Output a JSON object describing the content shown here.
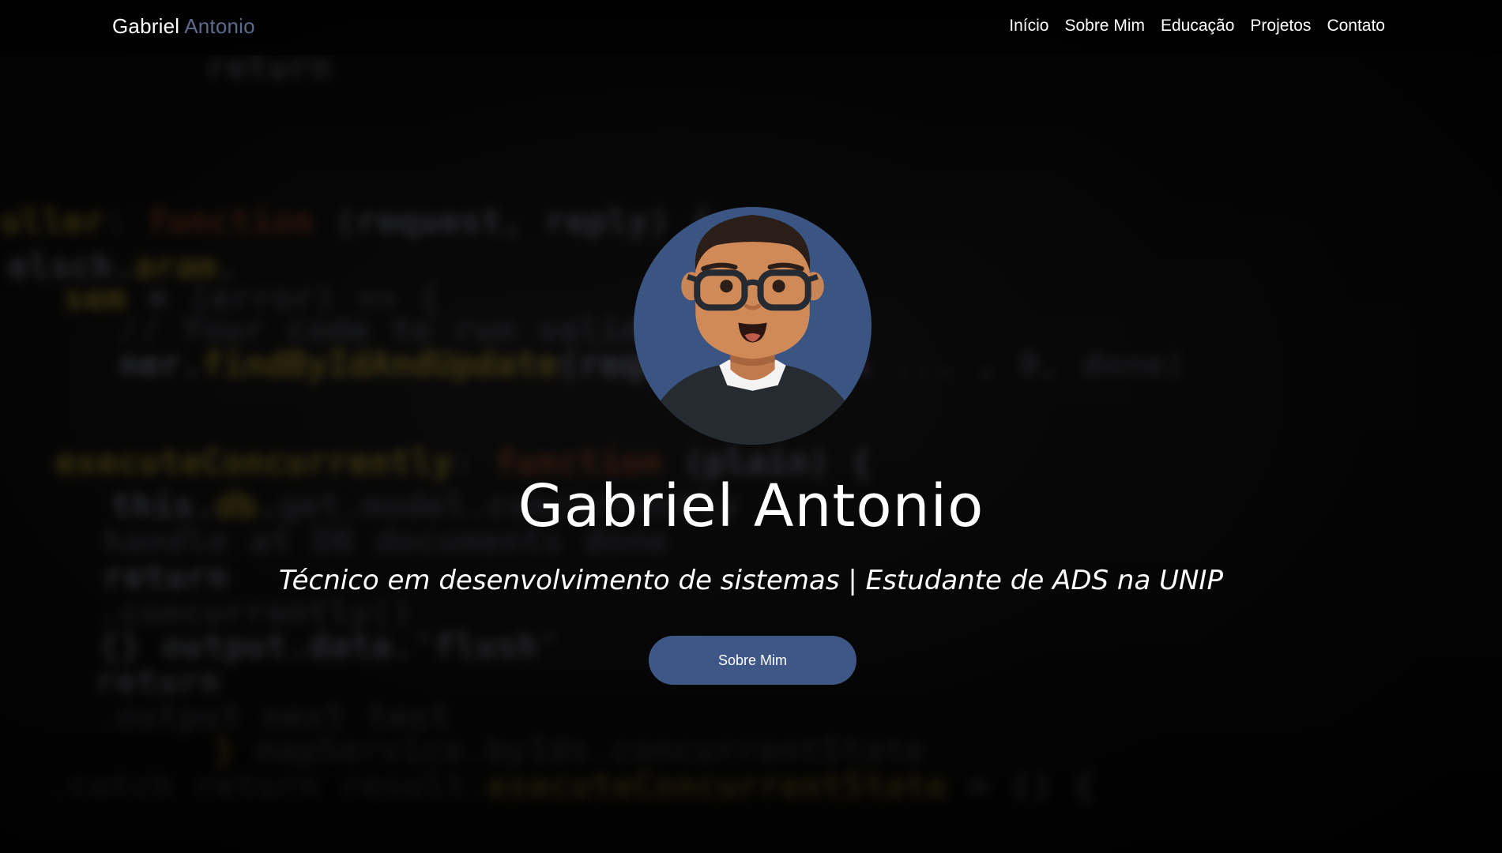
{
  "brand": {
    "first": "Gabriel",
    "last": "Antonio"
  },
  "nav": [
    {
      "label": "Início"
    },
    {
      "label": "Sobre Mim"
    },
    {
      "label": "Educação"
    },
    {
      "label": "Projetos"
    },
    {
      "label": "Contato"
    }
  ],
  "hero": {
    "name": "Gabriel Antonio",
    "subtitle": "Técnico em desenvolvimento de sistemas | Estudante de ADS na UNIP",
    "cta_label": "Sobre Mim"
  },
  "colors": {
    "accent": "#3f5786",
    "brand_secondary": "#5a6b8f",
    "avatar_bg": "#3b5582",
    "background": "#050505"
  },
  "avatar": {
    "icon": "developer-avatar-icon"
  }
}
